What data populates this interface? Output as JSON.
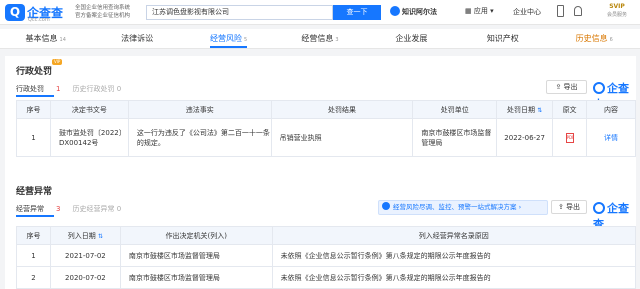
{
  "header": {
    "logo_glyph": "Q",
    "brand": "企查查",
    "brand_url": "Qcc.com",
    "tagline_line1": "全国企业信用查询系统",
    "tagline_line2": "官方备案企业征信机构",
    "search_value": "江苏调色盘影视有限公司",
    "search_button": "查一下",
    "zhishi": "知识阿尔法",
    "apps": "应用",
    "enterprise_center": "企业中心",
    "vip_label": "SVIP",
    "vip_sub": "会员服务"
  },
  "tabs": [
    {
      "label": "基本信息",
      "count": "14"
    },
    {
      "label": "法律诉讼",
      "count": ""
    },
    {
      "label": "经营风险",
      "count": "5"
    },
    {
      "label": "经营信息",
      "count": "3"
    },
    {
      "label": "企业发展",
      "count": ""
    },
    {
      "label": "知识产权",
      "count": ""
    },
    {
      "label": "历史信息",
      "count": "6"
    }
  ],
  "admin_penalty": {
    "title": "行政处罚",
    "vip": "VIP",
    "subtab_active": "行政处罚",
    "subtab_active_count": "1",
    "subtab_history": "历史行政处罚 0",
    "export": "导出",
    "watermark": "企查查",
    "columns": [
      "序号",
      "决定书文号",
      "违法事实",
      "处罚结果",
      "处罚单位",
      "处罚日期",
      "原文",
      "内容"
    ],
    "rows": [
      {
        "index": "1",
        "doc_no": "鼓市监处罚〔2022〕DX00142号",
        "fact": "这一行为违反了《公司法》第二百一十一条的规定。",
        "result": "吊销营业执照",
        "unit": "南京市鼓楼区市场监督管理局",
        "date": "2022-06-27",
        "original": "PDF",
        "detail": "详情"
      }
    ]
  },
  "abnormal": {
    "title": "经营异常",
    "subtab_active": "经营异常",
    "subtab_active_count": "3",
    "subtab_history": "历史经营异常 0",
    "banner": "经营风险尽调、监控、预警一站式解决方案",
    "export": "导出",
    "watermark": "企查查",
    "columns": [
      "序号",
      "列入日期",
      "作出决定机关(列入)",
      "列入经营异常名录原因"
    ],
    "rows": [
      {
        "index": "1",
        "date": "2021-07-02",
        "org": "南京市鼓楼区市场监督管理局",
        "reason": "未依照《企业信息公示暂行条例》第八条规定的期限公示年度报告的"
      },
      {
        "index": "2",
        "date": "2020-07-02",
        "org": "南京市鼓楼区市场监督管理局",
        "reason": "未依照《企业信息公示暂行条例》第八条规定的期限公示年度报告的"
      }
    ]
  }
}
